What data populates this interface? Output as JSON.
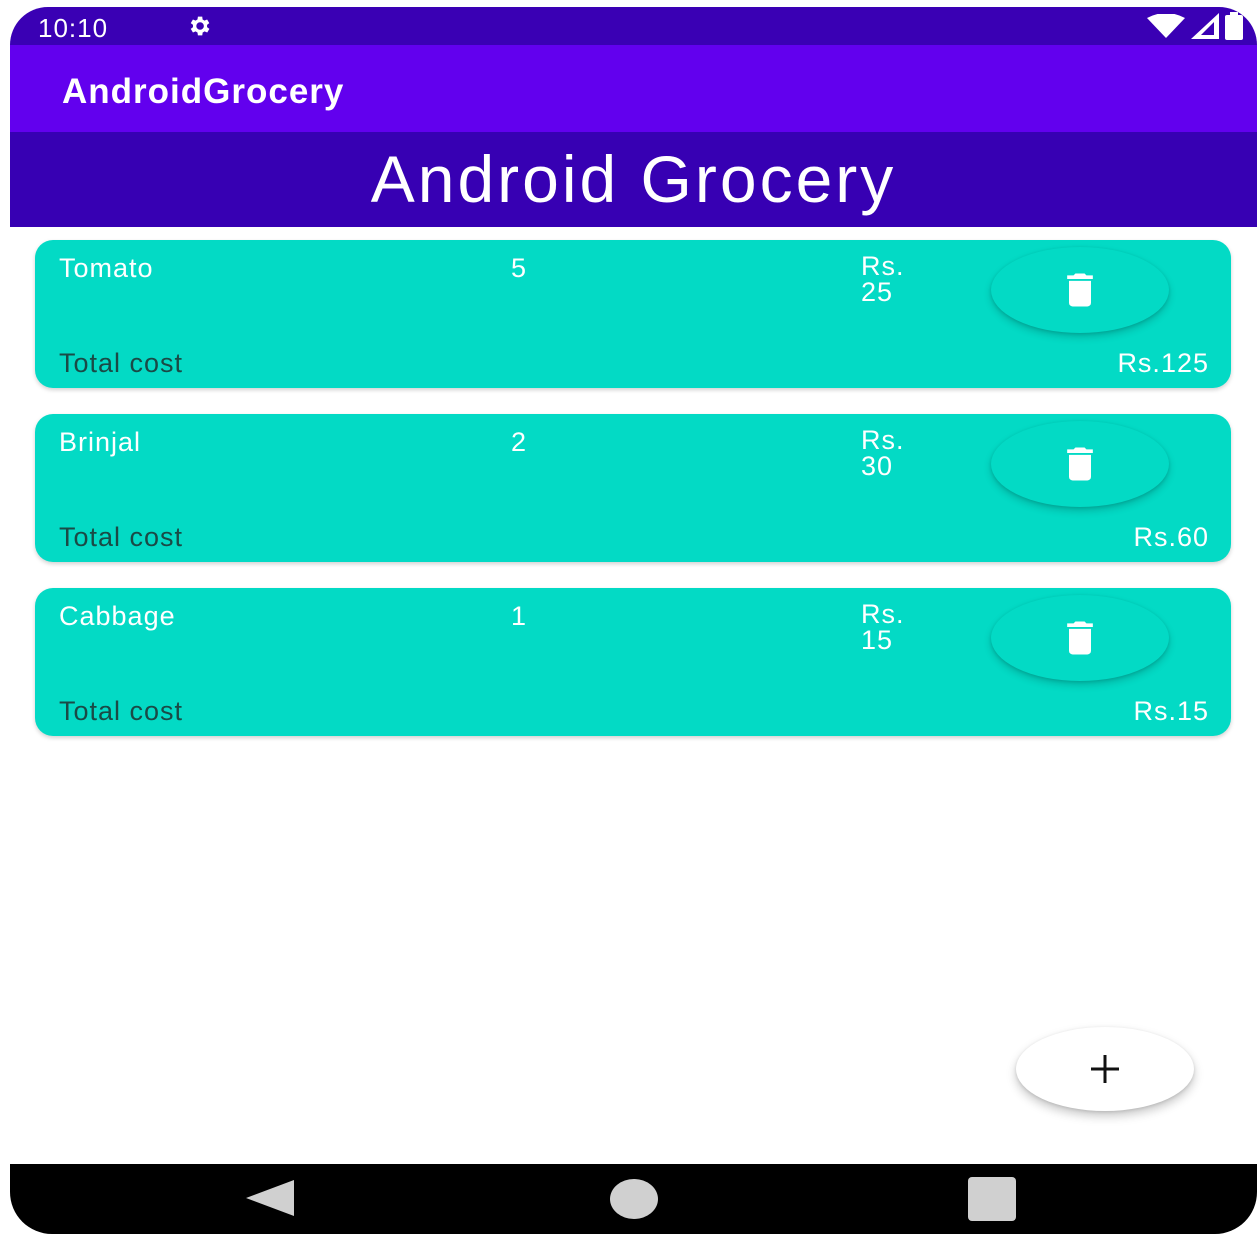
{
  "status_bar": {
    "time": "10:10",
    "icons": [
      "gear-icon",
      "wifi-icon",
      "signal-icon",
      "battery-icon"
    ]
  },
  "app_bar": {
    "title": "AndroidGrocery"
  },
  "header": {
    "title": "Android Grocery"
  },
  "items": [
    {
      "name": "Tomato",
      "quantity": "5",
      "price_label": "Rs.",
      "price_value": "25",
      "total_label": "Total cost",
      "total_value": "Rs.125"
    },
    {
      "name": "Brinjal",
      "quantity": "2",
      "price_label": "Rs.",
      "price_value": "30",
      "total_label": "Total cost",
      "total_value": "Rs.60"
    },
    {
      "name": "Cabbage",
      "quantity": "1",
      "price_label": "Rs.",
      "price_value": "15",
      "total_label": "Total cost",
      "total_value": "Rs.15"
    }
  ],
  "fab": {
    "icon": "plus-icon"
  },
  "nav_bar": {
    "buttons": [
      "back-icon",
      "home-icon",
      "recents-icon"
    ]
  },
  "colors": {
    "status_bar": "#3a00b4",
    "app_bar": "#6200ee",
    "header": "#3700b3",
    "card": "#03dac5",
    "total_label": "#1a4a46"
  }
}
